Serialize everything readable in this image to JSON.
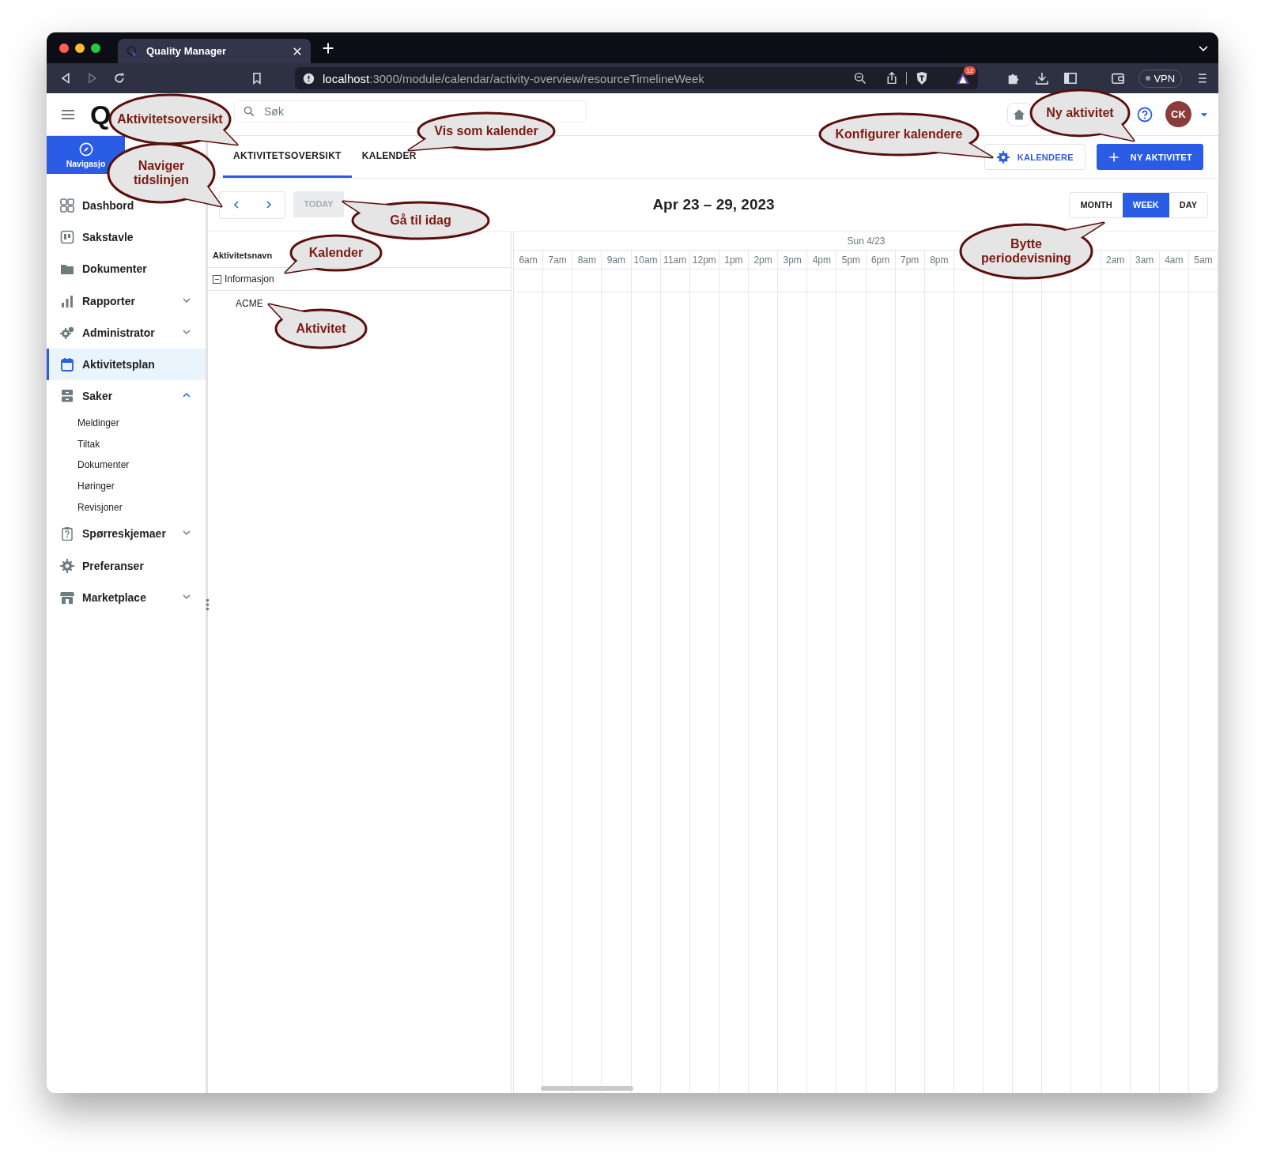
{
  "browser": {
    "tab_title": "Quality Manager",
    "url_host": "localhost",
    "url_path": ":3000/module/calendar/activity-overview/resourceTimelineWeek",
    "badge": "12",
    "vpn": "VPN"
  },
  "header": {
    "logo": "Q",
    "search": {
      "placeholder": "Søk"
    },
    "avatar": "CK"
  },
  "sidebar": {
    "nav_tab": "Navigasjo",
    "items": [
      {
        "label": "Dashbord",
        "selected": false
      },
      {
        "label": "Sakstavle",
        "selected": false
      },
      {
        "label": "Dokumenter",
        "selected": false
      },
      {
        "label": "Rapporter",
        "selected": false,
        "expanded": false
      },
      {
        "label": "Administrator",
        "selected": false,
        "expanded": false
      },
      {
        "label": "Aktivitetsplan",
        "selected": true
      },
      {
        "label": "Saker",
        "selected": false,
        "expanded": true,
        "children": [
          {
            "label": "Meldinger",
            "selected": false
          },
          {
            "label": "Tiltak",
            "selected": false
          },
          {
            "label": "Dokumenter",
            "selected": false
          },
          {
            "label": "Høringer",
            "selected": false
          },
          {
            "label": "Revisjoner",
            "selected": false
          }
        ]
      },
      {
        "label": "Spørreskjemaer",
        "selected": false,
        "expanded": false
      },
      {
        "label": "Preferanser",
        "selected": false
      },
      {
        "label": "Marketplace",
        "selected": false,
        "expanded": false
      }
    ]
  },
  "tabs": [
    {
      "label": "AKTIVITETSOVERSIKT",
      "selected": true
    },
    {
      "label": "KALENDER",
      "selected": false
    }
  ],
  "actions": [
    {
      "label": "KALENDERE",
      "kind": "outlined"
    },
    {
      "label": "NY AKTIVITET",
      "kind": "primary"
    }
  ],
  "toolbar": {
    "today": {
      "label": "TODAY",
      "disabled": true
    },
    "title": "Apr 23 – 29, 2023",
    "views": [
      {
        "label": "MONTH",
        "selected": false
      },
      {
        "label": "WEEK",
        "selected": true
      },
      {
        "label": "DAY",
        "selected": false
      }
    ]
  },
  "resources": {
    "header": "Aktivitetsnavn",
    "groups": [
      {
        "label": "Informasjon",
        "expanded": true,
        "children": [
          {
            "label": "ACME"
          }
        ]
      }
    ]
  },
  "timeline": {
    "day": "Sun 4/23",
    "hours_before": [
      "6am",
      "7am",
      "8am",
      "9am",
      "10am",
      "11am",
      "12pm",
      "1pm",
      "2pm",
      "3pm",
      "4pm",
      "5pm",
      "6pm",
      "7pm",
      "8pm"
    ],
    "hours_after": [
      "2am",
      "3am",
      "4am",
      "5am"
    ]
  },
  "callouts": [
    {
      "text": "Aktivitetsoversikt"
    },
    {
      "text": "Vis som kalender"
    },
    {
      "text": "Naviger tidslinjen"
    },
    {
      "text": "Gå til idag"
    },
    {
      "text": "Kalender"
    },
    {
      "text": "Aktivitet"
    },
    {
      "text": "Konfigurer kalendere"
    },
    {
      "text": "Ny aktivitet"
    },
    {
      "text": "Bytte periodevisning"
    }
  ]
}
